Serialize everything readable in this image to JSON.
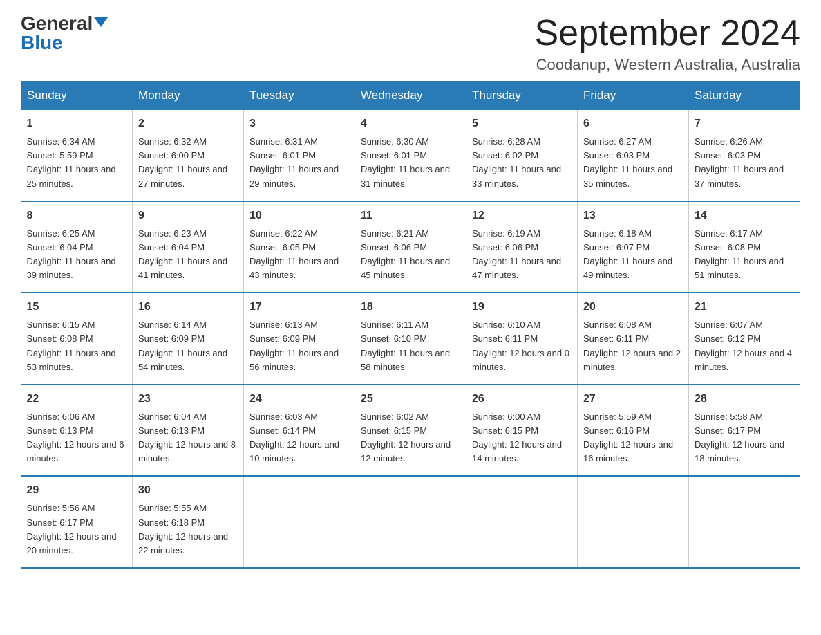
{
  "logo": {
    "general": "General",
    "blue": "Blue"
  },
  "title": "September 2024",
  "location": "Coodanup, Western Australia, Australia",
  "days": [
    "Sunday",
    "Monday",
    "Tuesday",
    "Wednesday",
    "Thursday",
    "Friday",
    "Saturday"
  ],
  "weeks": [
    [
      {
        "day": "1",
        "sunrise": "6:34 AM",
        "sunset": "5:59 PM",
        "daylight": "11 hours and 25 minutes."
      },
      {
        "day": "2",
        "sunrise": "6:32 AM",
        "sunset": "6:00 PM",
        "daylight": "11 hours and 27 minutes."
      },
      {
        "day": "3",
        "sunrise": "6:31 AM",
        "sunset": "6:01 PM",
        "daylight": "11 hours and 29 minutes."
      },
      {
        "day": "4",
        "sunrise": "6:30 AM",
        "sunset": "6:01 PM",
        "daylight": "11 hours and 31 minutes."
      },
      {
        "day": "5",
        "sunrise": "6:28 AM",
        "sunset": "6:02 PM",
        "daylight": "11 hours and 33 minutes."
      },
      {
        "day": "6",
        "sunrise": "6:27 AM",
        "sunset": "6:03 PM",
        "daylight": "11 hours and 35 minutes."
      },
      {
        "day": "7",
        "sunrise": "6:26 AM",
        "sunset": "6:03 PM",
        "daylight": "11 hours and 37 minutes."
      }
    ],
    [
      {
        "day": "8",
        "sunrise": "6:25 AM",
        "sunset": "6:04 PM",
        "daylight": "11 hours and 39 minutes."
      },
      {
        "day": "9",
        "sunrise": "6:23 AM",
        "sunset": "6:04 PM",
        "daylight": "11 hours and 41 minutes."
      },
      {
        "day": "10",
        "sunrise": "6:22 AM",
        "sunset": "6:05 PM",
        "daylight": "11 hours and 43 minutes."
      },
      {
        "day": "11",
        "sunrise": "6:21 AM",
        "sunset": "6:06 PM",
        "daylight": "11 hours and 45 minutes."
      },
      {
        "day": "12",
        "sunrise": "6:19 AM",
        "sunset": "6:06 PM",
        "daylight": "11 hours and 47 minutes."
      },
      {
        "day": "13",
        "sunrise": "6:18 AM",
        "sunset": "6:07 PM",
        "daylight": "11 hours and 49 minutes."
      },
      {
        "day": "14",
        "sunrise": "6:17 AM",
        "sunset": "6:08 PM",
        "daylight": "11 hours and 51 minutes."
      }
    ],
    [
      {
        "day": "15",
        "sunrise": "6:15 AM",
        "sunset": "6:08 PM",
        "daylight": "11 hours and 53 minutes."
      },
      {
        "day": "16",
        "sunrise": "6:14 AM",
        "sunset": "6:09 PM",
        "daylight": "11 hours and 54 minutes."
      },
      {
        "day": "17",
        "sunrise": "6:13 AM",
        "sunset": "6:09 PM",
        "daylight": "11 hours and 56 minutes."
      },
      {
        "day": "18",
        "sunrise": "6:11 AM",
        "sunset": "6:10 PM",
        "daylight": "11 hours and 58 minutes."
      },
      {
        "day": "19",
        "sunrise": "6:10 AM",
        "sunset": "6:11 PM",
        "daylight": "12 hours and 0 minutes."
      },
      {
        "day": "20",
        "sunrise": "6:08 AM",
        "sunset": "6:11 PM",
        "daylight": "12 hours and 2 minutes."
      },
      {
        "day": "21",
        "sunrise": "6:07 AM",
        "sunset": "6:12 PM",
        "daylight": "12 hours and 4 minutes."
      }
    ],
    [
      {
        "day": "22",
        "sunrise": "6:06 AM",
        "sunset": "6:13 PM",
        "daylight": "12 hours and 6 minutes."
      },
      {
        "day": "23",
        "sunrise": "6:04 AM",
        "sunset": "6:13 PM",
        "daylight": "12 hours and 8 minutes."
      },
      {
        "day": "24",
        "sunrise": "6:03 AM",
        "sunset": "6:14 PM",
        "daylight": "12 hours and 10 minutes."
      },
      {
        "day": "25",
        "sunrise": "6:02 AM",
        "sunset": "6:15 PM",
        "daylight": "12 hours and 12 minutes."
      },
      {
        "day": "26",
        "sunrise": "6:00 AM",
        "sunset": "6:15 PM",
        "daylight": "12 hours and 14 minutes."
      },
      {
        "day": "27",
        "sunrise": "5:59 AM",
        "sunset": "6:16 PM",
        "daylight": "12 hours and 16 minutes."
      },
      {
        "day": "28",
        "sunrise": "5:58 AM",
        "sunset": "6:17 PM",
        "daylight": "12 hours and 18 minutes."
      }
    ],
    [
      {
        "day": "29",
        "sunrise": "5:56 AM",
        "sunset": "6:17 PM",
        "daylight": "12 hours and 20 minutes."
      },
      {
        "day": "30",
        "sunrise": "5:55 AM",
        "sunset": "6:18 PM",
        "daylight": "12 hours and 22 minutes."
      },
      null,
      null,
      null,
      null,
      null
    ]
  ]
}
